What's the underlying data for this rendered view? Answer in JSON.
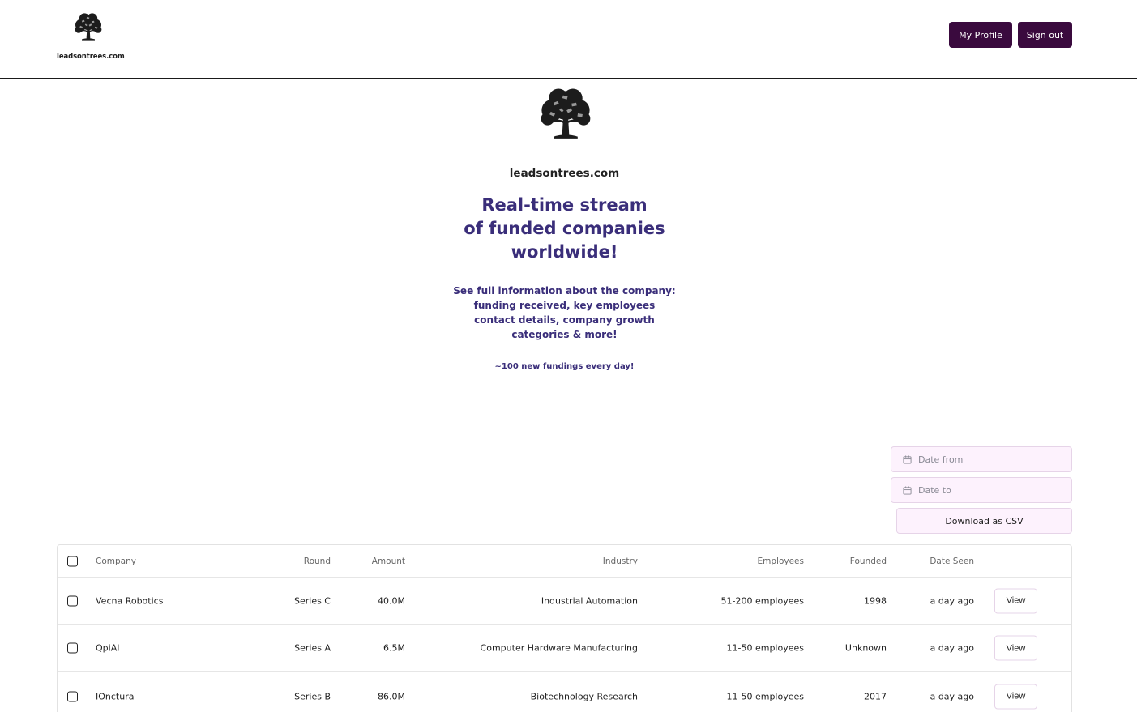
{
  "header": {
    "brand_name": "leadsontrees.com",
    "brand_icon": "tree-logo-icon",
    "profile_label": "My Profile",
    "signout_label": "Sign out",
    "button_color": "#3a0a3e"
  },
  "hero": {
    "site_name": "leadsontrees.com",
    "title_lines": [
      "Real-time stream",
      "of funded companies",
      "worldwide!"
    ],
    "subtitle_lines": [
      "See full information about the company:",
      "funding received, key employees",
      "contact details, company growth",
      "categories & more!"
    ],
    "note": "~100 new fundings every day!",
    "accent_color": "#3a2e7a"
  },
  "filters": {
    "date_from_placeholder": "Date from",
    "date_to_placeholder": "Date to",
    "download_label": "Download as CSV"
  },
  "table": {
    "columns": {
      "company": "Company",
      "round": "Round",
      "amount": "Amount",
      "industry": "Industry",
      "employees": "Employees",
      "founded": "Founded",
      "date_seen": "Date Seen"
    },
    "rows": [
      {
        "company": "Vecna Robotics",
        "round": "Series C",
        "amount": "40.0M",
        "industry": "Industrial Automation",
        "employees": "51-200 employees",
        "founded": "1998",
        "date_seen": "a day ago",
        "action": "View",
        "checked": false
      },
      {
        "company": "QpiAI",
        "round": "Series A",
        "amount": "6.5M",
        "industry": "Computer Hardware Manufacturing",
        "employees": "11-50 employees",
        "founded": "Unknown",
        "date_seen": "a day ago",
        "action": "View",
        "checked": false
      },
      {
        "company": "IOnctura",
        "round": "Series B",
        "amount": "86.0M",
        "industry": "Biotechnology Research",
        "employees": "11-50 employees",
        "founded": "2017",
        "date_seen": "a day ago",
        "action": "View",
        "checked": false
      }
    ]
  }
}
